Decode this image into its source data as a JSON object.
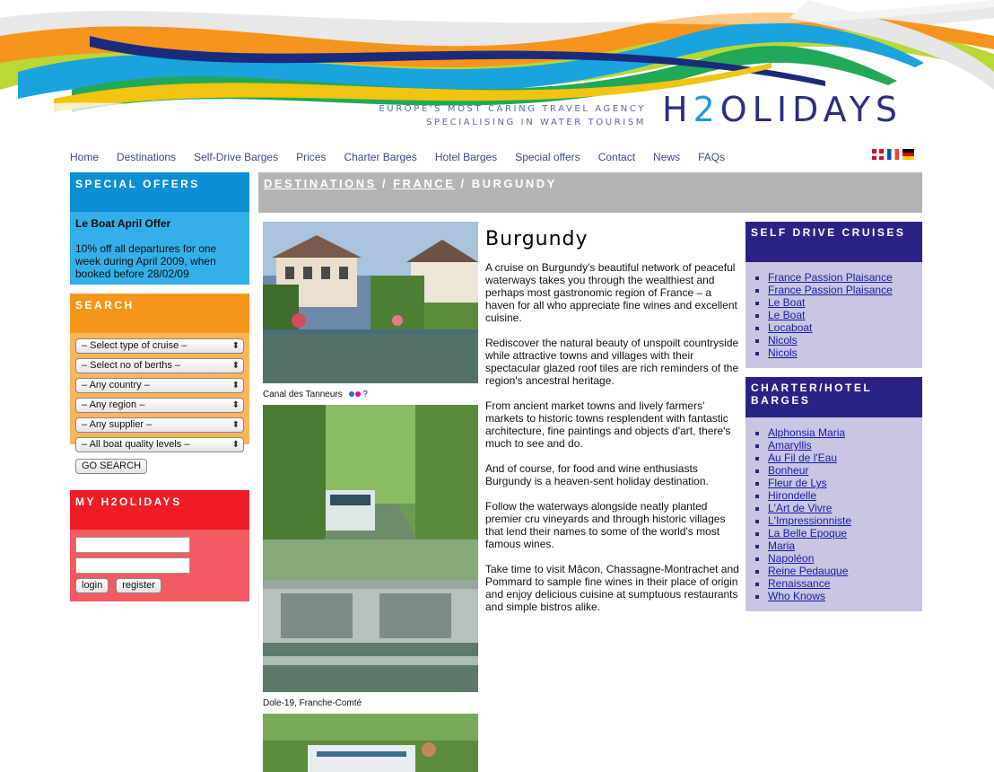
{
  "header": {
    "tagline_line1": "EUROPE'S MOST CARING TRAVEL AGENCY",
    "tagline_line2": "SPECIALISING IN WATER TOURISM",
    "logo_part1": "H",
    "logo_part2": "2",
    "logo_part3": "OLIDAYS"
  },
  "nav": {
    "items": [
      "Home",
      "Destinations",
      "Self-Drive Barges",
      "Prices",
      "Charter Barges",
      "Hotel Barges",
      "Special offers",
      "Contact",
      "News",
      "FAQs"
    ]
  },
  "languages": [
    "english-flag-icon",
    "french-flag-icon",
    "german-flag-icon"
  ],
  "special_offers": {
    "title": "SPECIAL OFFERS",
    "offer_title": "Le Boat April Offer",
    "offer_text": "10% off all departures for one week during April 2009, when booked before 28/02/09"
  },
  "search": {
    "title": "SEARCH",
    "selects": [
      "– Select type of cruise –",
      "– Select no of berths –",
      "– Any country –",
      "– Any region –",
      "– Any supplier –",
      "– All boat quality levels –"
    ],
    "button": "GO SEARCH"
  },
  "my_account": {
    "title": "MY H2OLIDAYS",
    "login": "login",
    "register": "register"
  },
  "breadcrumb": {
    "destinations": "DESTINATIONS",
    "sep1": " / ",
    "france": "FRANCE",
    "sep2": " / ",
    "current": "BURGUNDY"
  },
  "photos": {
    "caption1": "Canal des Tanneurs",
    "caption1_q": "?",
    "caption2": "Dole-19, Franche-Comté"
  },
  "article": {
    "title": "Burgundy",
    "paragraphs": [
      "A cruise on Burgundy's beautiful network of peaceful waterways takes you through the wealthiest and perhaps most gastronomic region of France – a haven for all who appreciate fine wines and excellent cuisine.",
      "Rediscover the natural beauty of unspoilt countryside while attractive towns and villages with their spectacular glazed roof tiles are rich reminders of the region's ancestral heritage.",
      "From ancient market towns and lively farmers' markets to historic towns resplendent with fantastic architecture, fine paintings and objects d'art, there's much to see and do.",
      "And of course, for food and wine enthusiasts Burgundy is a heaven-sent holiday destination.",
      "Follow the waterways alongside neatly planted premier cru vineyards and through historic villages that lend their names to some of the world's most famous wines.",
      "Take time to visit Mâcon, Chassagne-Montrachet and Pommard to sample fine wines in their place of origin and enjoy delicious cuisine at sumptuous restaurants and simple bistros alike."
    ]
  },
  "self_drive": {
    "title": "SELF DRIVE CRUISES",
    "items": [
      "France Passion Plaisance",
      "France Passion Plaisance",
      "Le Boat",
      "Le Boat",
      "Locaboat",
      "Nicols",
      "Nicols"
    ]
  },
  "charter_hotel": {
    "title_line1": "CHARTER/HOTEL",
    "title_line2": "BARGES",
    "items": [
      "Alphonsia Maria",
      "Amaryllis",
      "Au Fil de l'Eau",
      "Bonheur",
      "Fleur de Lys",
      "Hirondelle",
      "L'Art de Vivre",
      "L'Impressionniste",
      "La Belle Epoque",
      "Maria",
      "Napoléon",
      "Reine Pedauque",
      "Renaissance",
      "Who Knows"
    ]
  },
  "colors": {
    "offers": "#0d8fd6",
    "search": "#f6961a",
    "my_account": "#ee1c25",
    "right_panel": "#2b2383",
    "breadcrumb": "#b4b4b4"
  }
}
